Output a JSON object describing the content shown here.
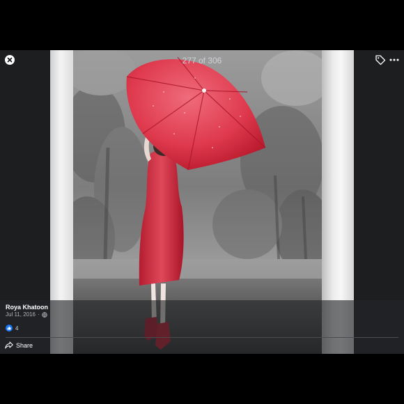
{
  "viewer": {
    "counter": "277 of 306"
  },
  "post": {
    "author": "Roya Khatoon",
    "date": "Jul 11, 2016",
    "date_separator": "·",
    "like_count": "4",
    "share_label": "Share"
  },
  "icons": {
    "close": "close-icon",
    "tag": "tag-icon",
    "more": "more-icon",
    "globe": "globe-icon",
    "like": "like-icon",
    "share": "share-icon"
  },
  "colors": {
    "accent_red": "#d8283c",
    "like_blue": "#1877f2",
    "panel": "#232528",
    "background": "#1d1e20"
  }
}
